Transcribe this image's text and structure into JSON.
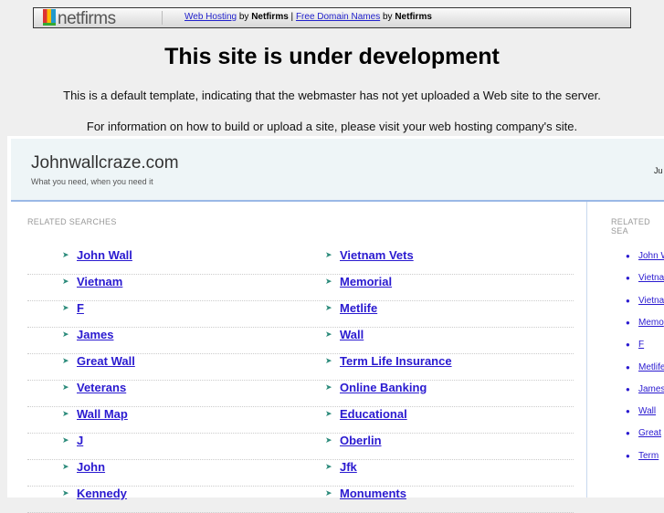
{
  "topbar": {
    "logo": "netfirms",
    "link1": "Web Hosting",
    "by1": " by ",
    "brand1": "Netfirms",
    "pipe": " | ",
    "link2": "Free Domain Names",
    "by2": " by ",
    "brand2": "Netfirms"
  },
  "title": "This site is under development",
  "info1": "This is a default template, indicating that the webmaster has not yet uploaded a Web site to the server.",
  "info2": "For information on how to build or upload a site, please visit your web hosting company's site.",
  "site": {
    "name": "Johnwallcraze.com",
    "tagline": "What you need, when you need it",
    "right_text": "Ju"
  },
  "main": {
    "heading": "RELATED SEARCHES",
    "col1": [
      "John Wall",
      "Vietnam",
      "F",
      "James",
      "Great Wall",
      "Veterans",
      "Wall Map",
      "J",
      "John",
      "Kennedy"
    ],
    "col2": [
      "Vietnam Vets",
      "Memorial",
      "Metlife",
      "Wall",
      "Term Life Insurance",
      "Online Banking",
      "Educational",
      "Oberlin",
      "Jfk",
      "Monuments"
    ]
  },
  "side": {
    "heading": "RELATED SEA",
    "items": [
      "John W",
      "Vietna",
      "Vietna",
      "Memo",
      "F",
      "Metlife",
      "James",
      "Wall",
      "Great",
      "Term"
    ]
  }
}
